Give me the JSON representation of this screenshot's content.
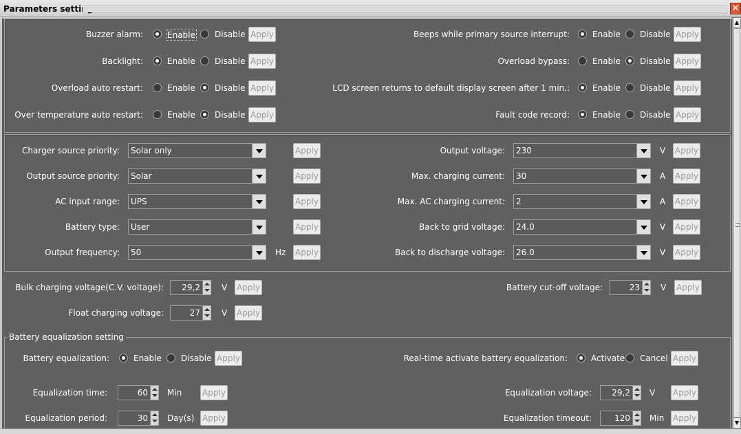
{
  "window": {
    "title": "Parameters setting",
    "close_glyph": "✕"
  },
  "common": {
    "enable": "Enable",
    "disable": "Disable",
    "apply": "Apply"
  },
  "toggles_left": [
    {
      "label": "Buzzer alarm:",
      "selected": "enable"
    },
    {
      "label": "Backlight:",
      "selected": "enable"
    },
    {
      "label": "Overload auto restart:",
      "selected": "disable"
    },
    {
      "label": "Over temperature auto restart:",
      "selected": "disable"
    }
  ],
  "toggles_right": [
    {
      "label": "Beeps while primary source interrupt:",
      "selected": "enable"
    },
    {
      "label": "Overload bypass:",
      "selected": "disable"
    },
    {
      "label": "LCD screen returns to default display screen after 1 min.:",
      "selected": "enable"
    },
    {
      "label": "Fault code record:",
      "selected": "enable"
    }
  ],
  "combos_left": [
    {
      "label": "Charger source priority:",
      "value": "Solar only",
      "unit": ""
    },
    {
      "label": "Output source priority:",
      "value": "Solar",
      "unit": ""
    },
    {
      "label": "AC input range:",
      "value": "UPS",
      "unit": ""
    },
    {
      "label": "Battery type:",
      "value": "User",
      "unit": ""
    },
    {
      "label": "Output frequency:",
      "value": "50",
      "unit": "Hz"
    }
  ],
  "combos_right": [
    {
      "label": "Output voltage:",
      "value": "230",
      "unit": "V"
    },
    {
      "label": "Max. charging current:",
      "value": "30",
      "unit": "A"
    },
    {
      "label": "Max. AC charging current:",
      "value": "2",
      "unit": "A"
    },
    {
      "label": "Back to grid voltage:",
      "value": "24.0",
      "unit": "V"
    },
    {
      "label": "Back to discharge voltage:",
      "value": "26.0",
      "unit": "V"
    }
  ],
  "voltages": {
    "bulk": {
      "label": "Bulk charging voltage(C.V. voltage):",
      "value": "29,2",
      "unit": "V"
    },
    "float": {
      "label": "Float charging voltage:",
      "value": "27",
      "unit": "V"
    },
    "cutoff": {
      "label": "Battery cut-off voltage:",
      "value": "23",
      "unit": "V"
    }
  },
  "equalization": {
    "group_title": "Battery equalization setting",
    "battery_eq": {
      "label": "Battery equalization:",
      "selected": "enable"
    },
    "realtime": {
      "label": "Real-time activate battery equalization:",
      "activate": "Activate",
      "cancel": "Cancel",
      "selected": "activate"
    },
    "time": {
      "label": "Equalization time:",
      "value": "60",
      "unit": "Min"
    },
    "period": {
      "label": "Equalization period:",
      "value": "30",
      "unit": "Day(s)"
    },
    "voltage": {
      "label": "Equalization voltage:",
      "value": "29,2",
      "unit": "V"
    },
    "timeout": {
      "label": "Equalization timeout:",
      "value": "120",
      "unit": "Min"
    }
  },
  "colors": {
    "background": "#606060",
    "button_face": "#ececec",
    "button_text_disabled": "#9a9a9a",
    "close_button": "#d95c3a"
  }
}
